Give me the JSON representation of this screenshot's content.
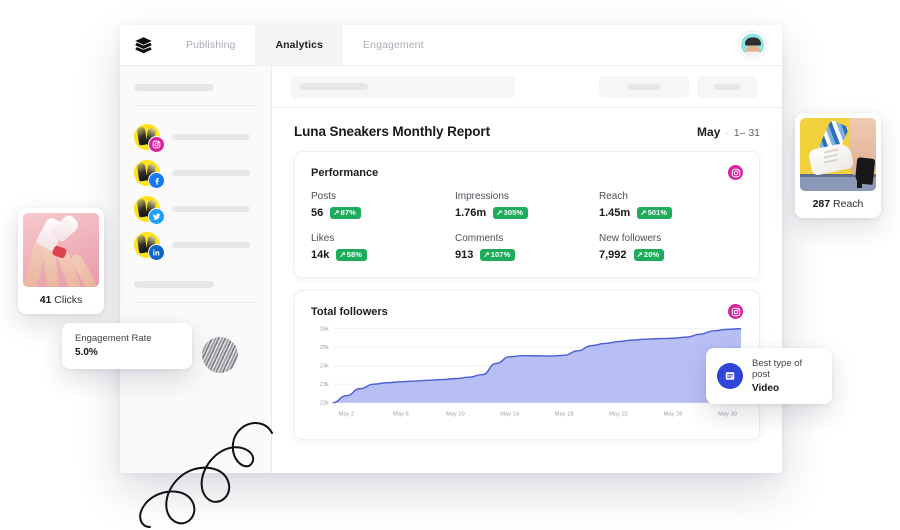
{
  "app": {
    "logo_icon": "layers-stack-icon",
    "tabs": [
      {
        "label": "Publishing",
        "active": false
      },
      {
        "label": "Analytics",
        "active": true
      },
      {
        "label": "Engagement",
        "active": false
      }
    ],
    "user_avatar": "user-avatar"
  },
  "sidebar": {
    "accounts": [
      {
        "network": "instagram-icon",
        "color": "#d6249f"
      },
      {
        "network": "facebook-icon",
        "color": "#1877f2"
      },
      {
        "network": "twitter-icon",
        "color": "#1da1f2"
      },
      {
        "network": "linkedin-icon",
        "color": "#0a66c2"
      }
    ]
  },
  "report": {
    "title": "Luna Sneakers Monthly Report",
    "month": "May",
    "separator": "·",
    "range": "1– 31"
  },
  "performance": {
    "title": "Performance",
    "network_icon": "instagram-icon",
    "metrics": [
      {
        "label": "Posts",
        "value": "56",
        "change": "87%",
        "arrow": "↗"
      },
      {
        "label": "Impressions",
        "value": "1.76m",
        "change": "305%",
        "arrow": "↗"
      },
      {
        "label": "Reach",
        "value": "1.45m",
        "change": "501%",
        "arrow": "↗"
      },
      {
        "label": "Likes",
        "value": "14k",
        "change": "58%",
        "arrow": "↗"
      },
      {
        "label": "Comments",
        "value": "913",
        "change": "107%",
        "arrow": "↗"
      },
      {
        "label": "New followers",
        "value": "7,992",
        "change": "20%",
        "arrow": "↗"
      }
    ],
    "badge_color": "#1dac5c"
  },
  "followers_card": {
    "title": "Total followers",
    "network_icon": "instagram-icon"
  },
  "chart_data": {
    "type": "area",
    "title": "Total followers",
    "xlabel": "",
    "ylabel": "",
    "ylim": [
      22000,
      26000
    ],
    "yticks": [
      22000,
      23000,
      24000,
      25000,
      26000
    ],
    "ytick_labels": [
      "22k",
      "23k",
      "24k",
      "25k",
      "26k"
    ],
    "xticks": [
      "May 2",
      "May 6",
      "May 10",
      "May 14",
      "May 18",
      "May 22",
      "May 26",
      "May 30"
    ],
    "grid": true,
    "legend": "none",
    "line_color": "#4c5fd7",
    "fill_color": "#a3adf2",
    "x": [
      1,
      2,
      3,
      4,
      5,
      6,
      7,
      8,
      9,
      10,
      11,
      12,
      13,
      14,
      15,
      16,
      17,
      18,
      19,
      20,
      21,
      22,
      23,
      24,
      25,
      26,
      27,
      28,
      29,
      30,
      31
    ],
    "values": [
      22000,
      22380,
      22760,
      23000,
      23080,
      23130,
      23170,
      23210,
      23250,
      23300,
      23380,
      23520,
      24120,
      24480,
      24540,
      24530,
      24520,
      24560,
      24800,
      25080,
      25200,
      25300,
      25380,
      25430,
      25460,
      25480,
      25540,
      25700,
      25880,
      25960,
      26000
    ]
  },
  "float_cards": {
    "clicks": {
      "value": "41",
      "label": "Clicks",
      "image": "pink-sneaker-photo"
    },
    "reach": {
      "value": "287",
      "label": "Reach",
      "image": "yellow-sneaker-photo"
    },
    "engagement": {
      "label": "Engagement Rate",
      "value": "5.0%"
    },
    "best_post": {
      "label": "Best type of post",
      "value": "Video",
      "icon": "video-post-icon",
      "icon_color": "#2f46d8"
    }
  }
}
